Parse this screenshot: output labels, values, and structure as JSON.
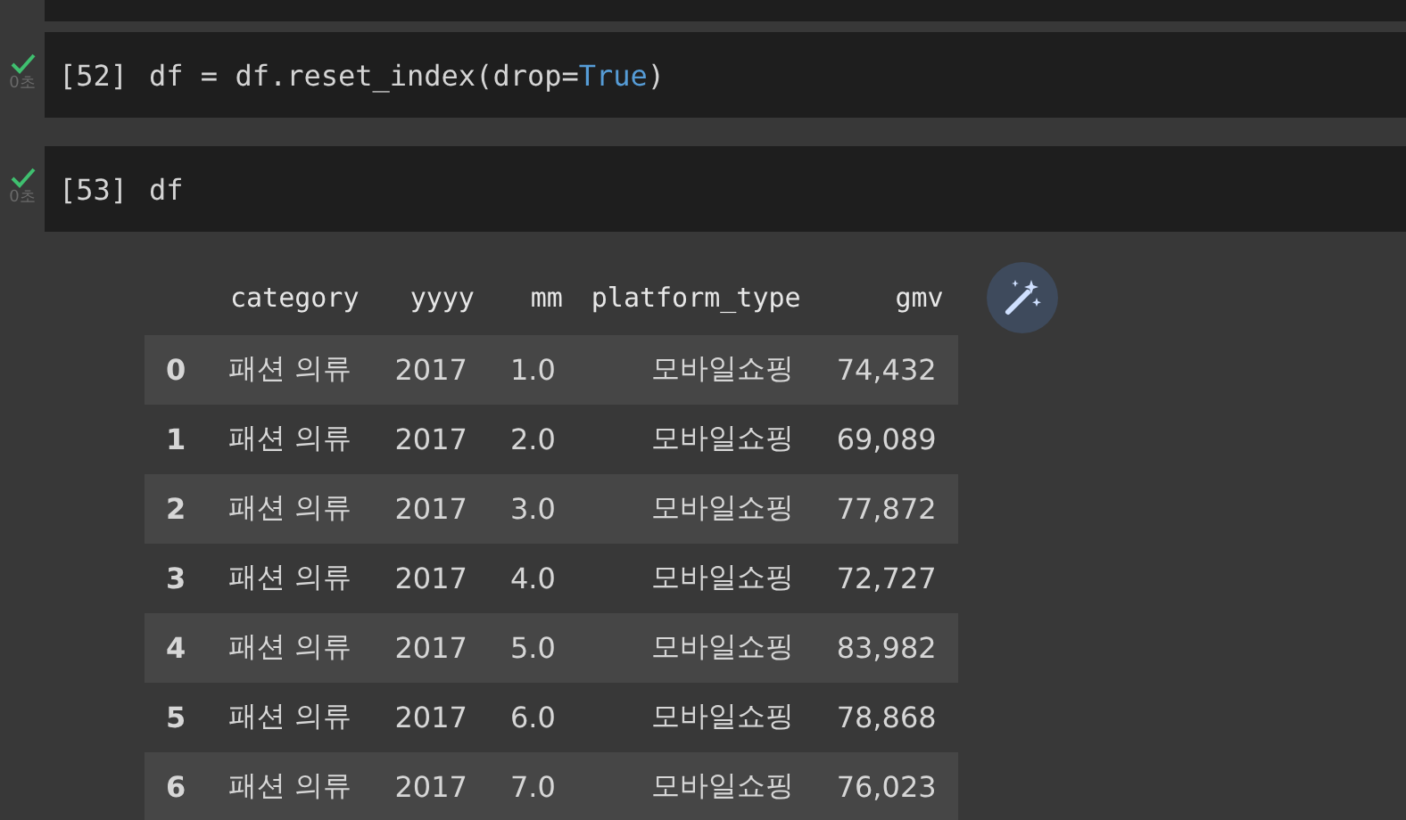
{
  "cells": [
    {
      "done": true,
      "elapsed": "0초",
      "prompt": "[52]",
      "tokens": [
        {
          "kind": "plain",
          "text": "df = df.reset_index(drop="
        },
        {
          "kind": "keyword",
          "text": "True"
        },
        {
          "kind": "plain",
          "text": ")"
        }
      ]
    },
    {
      "done": true,
      "elapsed": "0초",
      "prompt": "[53]",
      "tokens": [
        {
          "kind": "plain",
          "text": "df"
        }
      ]
    }
  ],
  "table": {
    "columns": [
      "",
      "category",
      "yyyy",
      "mm",
      "platform_type",
      "gmv"
    ],
    "rows": [
      [
        "0",
        "패션 의류",
        "2017",
        "1.0",
        "모바일쇼핑",
        "74,432"
      ],
      [
        "1",
        "패션 의류",
        "2017",
        "2.0",
        "모바일쇼핑",
        "69,089"
      ],
      [
        "2",
        "패션 의류",
        "2017",
        "3.0",
        "모바일쇼핑",
        "77,872"
      ],
      [
        "3",
        "패션 의류",
        "2017",
        "4.0",
        "모바일쇼핑",
        "72,727"
      ],
      [
        "4",
        "패션 의류",
        "2017",
        "5.0",
        "모바일쇼핑",
        "83,982"
      ],
      [
        "5",
        "패션 의류",
        "2017",
        "6.0",
        "모바일쇼핑",
        "78,868"
      ],
      [
        "6",
        "패션 의류",
        "2017",
        "7.0",
        "모바일쇼핑",
        "76,023"
      ]
    ]
  }
}
